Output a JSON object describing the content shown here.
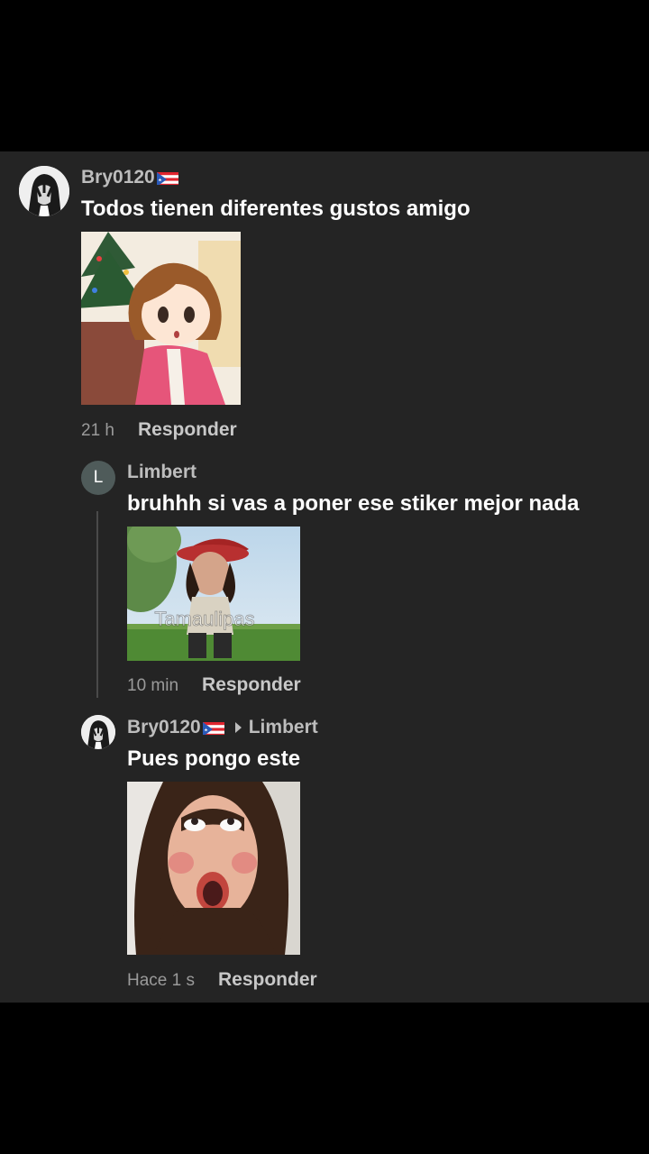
{
  "comments": [
    {
      "user": "Bry0120",
      "text": "Todos tienen diferentes gustos amigo",
      "time": "21 h",
      "reply": "Responder",
      "sticker": "anime-girl-christmas-sticker"
    },
    {
      "avatar_letter": "L",
      "user": "Limbert",
      "text": "bruhhh si vas a poner ese stiker mejor nada",
      "time": "10 min",
      "reply": "Responder",
      "sticker_caption": "Tamaulipas"
    },
    {
      "user": "Bry0120",
      "reply_to": "Limbert",
      "text": "Pues pongo este",
      "time": "Hace 1 s",
      "reply": "Responder",
      "sticker": "woman-face-sticker"
    }
  ],
  "colors": {
    "panel": "#242424",
    "username": "#bdbdbd",
    "text": "#ffffff",
    "timestamp": "#9a9a9a"
  },
  "icons": [
    "flag-puerto-rico-icon",
    "reply-arrow-icon"
  ]
}
